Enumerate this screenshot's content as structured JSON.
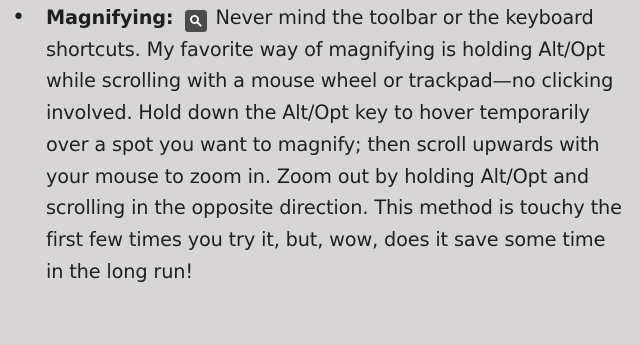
{
  "item": {
    "term": "Magnifying:",
    "icon": "magnifier-icon",
    "body": "Never mind the toolbar or the keyboard shortcuts. My favorite way of magnifying is holding Alt/Opt while scrolling with a mouse wheel or trackpad—no clicking involved. Hold down the Alt/Opt key to hover temporarily over a spot you want to magnify; then scroll upwards with your mouse to zoom in. Zoom out by holding Alt/Opt and scrolling in the opposite direction. This method is touchy the first few times you try it, but, wow, does it save some time in the long run!"
  },
  "colors": {
    "background": "#d7d6d4",
    "text": "#1f1f1f",
    "icon_bg": "#4b4b4b",
    "icon_fg": "#ffffff"
  }
}
